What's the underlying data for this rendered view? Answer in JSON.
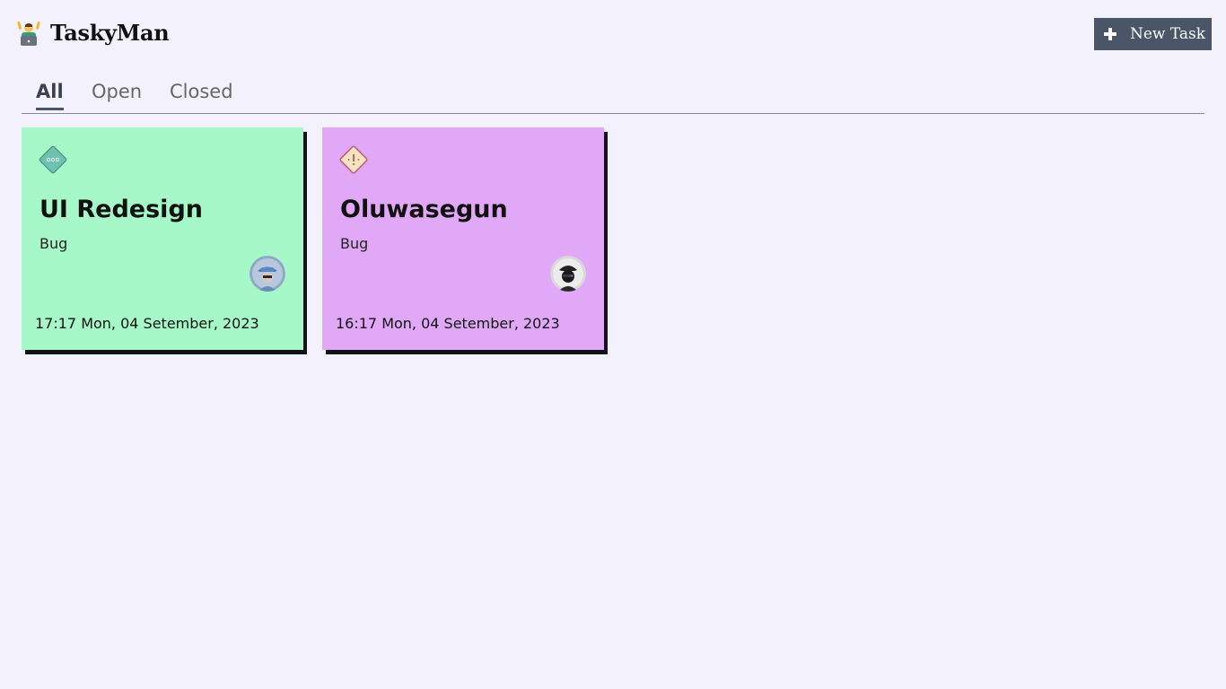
{
  "app": {
    "title": "TaskyMan",
    "logo_icon": "person-raising-hands-icon"
  },
  "toolbar": {
    "new_task_label": "New Task",
    "new_task_icon": "plus-icon"
  },
  "tabs": [
    {
      "label": "All",
      "active": true
    },
    {
      "label": "Open",
      "active": false
    },
    {
      "label": "Closed",
      "active": false
    }
  ],
  "tasks": [
    {
      "title": "UI Redesign",
      "type": "Bug",
      "date": "17:17 Mon, 04 Setember, 2023",
      "color": "#a6f8c8",
      "priority_icon": "diamond-dots-icon",
      "avatar": "user-avatar"
    },
    {
      "title": "Oluwasegun",
      "type": "Bug",
      "date": "16:17 Mon, 04 Setember, 2023",
      "color": "#e2a8f8",
      "priority_icon": "diamond-warning-icon",
      "avatar": "user-avatar"
    }
  ],
  "colors": {
    "background": "#f3f2fc",
    "button": "#4a5567"
  }
}
